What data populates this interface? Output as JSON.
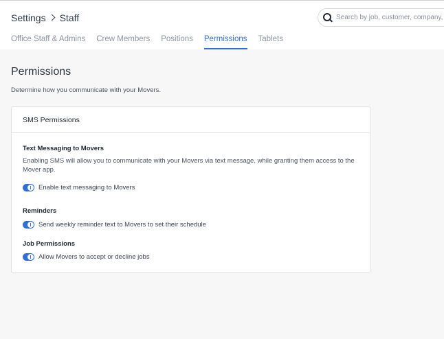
{
  "breadcrumb": {
    "root": "Settings",
    "current": "Staff"
  },
  "search": {
    "placeholder": "Search by job, customer, company, etc."
  },
  "tabs": [
    {
      "label": "Office Staff & Admins",
      "active": false
    },
    {
      "label": "Crew Members",
      "active": false
    },
    {
      "label": "Positions",
      "active": false
    },
    {
      "label": "Permissions",
      "active": true
    },
    {
      "label": "Tablets",
      "active": false
    }
  ],
  "page": {
    "title": "Permissions",
    "subtitle": "Determine how you communicate with your Movers."
  },
  "card": {
    "title": "SMS Permissions",
    "sections": [
      {
        "title": "Text Messaging to Movers",
        "description": "Enabling SMS will allow you to communicate with your Movers via text message, while granting them access to the Mover app.",
        "toggle_label": "Enable text messaging to Movers",
        "enabled": true
      },
      {
        "title": "Reminders",
        "toggle_label": "Send weekly reminder text to Movers to set their schedule",
        "enabled": true
      },
      {
        "title": "Job Permissions",
        "toggle_label": "Allow Movers to accept or decline jobs",
        "enabled": true
      }
    ]
  },
  "colors": {
    "accent": "#2f6fd6",
    "background": "#f7f7f7",
    "card": "#ffffff"
  }
}
